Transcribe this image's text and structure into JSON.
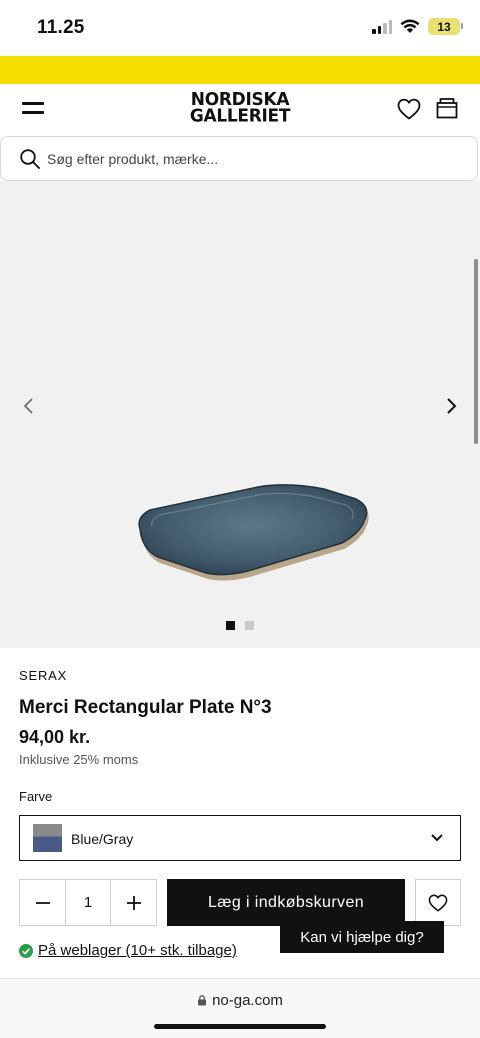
{
  "status_bar": {
    "time": "11.25",
    "battery": "13"
  },
  "header": {
    "logo_line1": "NORDISKA",
    "logo_line2": "GALLERIET"
  },
  "search": {
    "placeholder": "Søg efter produkt, mærke..."
  },
  "gallery": {
    "image_count": 2,
    "active_index": 0
  },
  "product": {
    "brand": "SERAX",
    "title": "Merci Rectangular Plate N°3",
    "price": "94,00 kr.",
    "vat_note": "Inklusive 25% moms",
    "color_label": "Farve",
    "color_value": "Blue/Gray",
    "quantity": "1",
    "add_to_cart_label": "Læg i indkøbskurven",
    "stock_text": "På weblager (10+ stk. tilbage)"
  },
  "help_chip": {
    "label": "Kan vi hjælpe dig?"
  },
  "browser": {
    "url": "no-ga.com"
  },
  "colors": {
    "promo": "#f6dd00",
    "accent": "#111111",
    "stock_green": "#27a048"
  }
}
